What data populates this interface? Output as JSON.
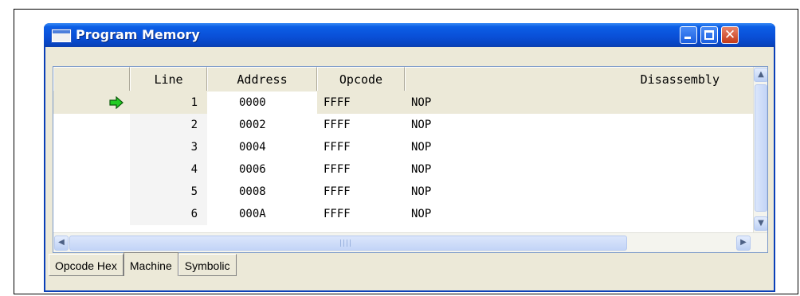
{
  "window": {
    "title": "Program Memory",
    "title_color": "#ffffff",
    "titlebar_color": "#0a50d8"
  },
  "table": {
    "columns": [
      "Line",
      "Address",
      "Opcode",
      "Disassembly"
    ],
    "rows": [
      {
        "line": "1",
        "address": "0000",
        "opcode": "FFFF",
        "disassembly": "NOP",
        "current": true
      },
      {
        "line": "2",
        "address": "0002",
        "opcode": "FFFF",
        "disassembly": "NOP"
      },
      {
        "line": "3",
        "address": "0004",
        "opcode": "FFFF",
        "disassembly": "NOP"
      },
      {
        "line": "4",
        "address": "0006",
        "opcode": "FFFF",
        "disassembly": "NOP"
      },
      {
        "line": "5",
        "address": "0008",
        "opcode": "FFFF",
        "disassembly": "NOP"
      },
      {
        "line": "6",
        "address": "000A",
        "opcode": "FFFF",
        "disassembly": "NOP"
      }
    ],
    "current_line_icon": "green-right-arrow-icon",
    "current_line_color": "#ece9d8"
  },
  "tabs": [
    {
      "label": "Opcode Hex"
    },
    {
      "label": "Machine",
      "active": true
    },
    {
      "label": "Symbolic"
    }
  ]
}
